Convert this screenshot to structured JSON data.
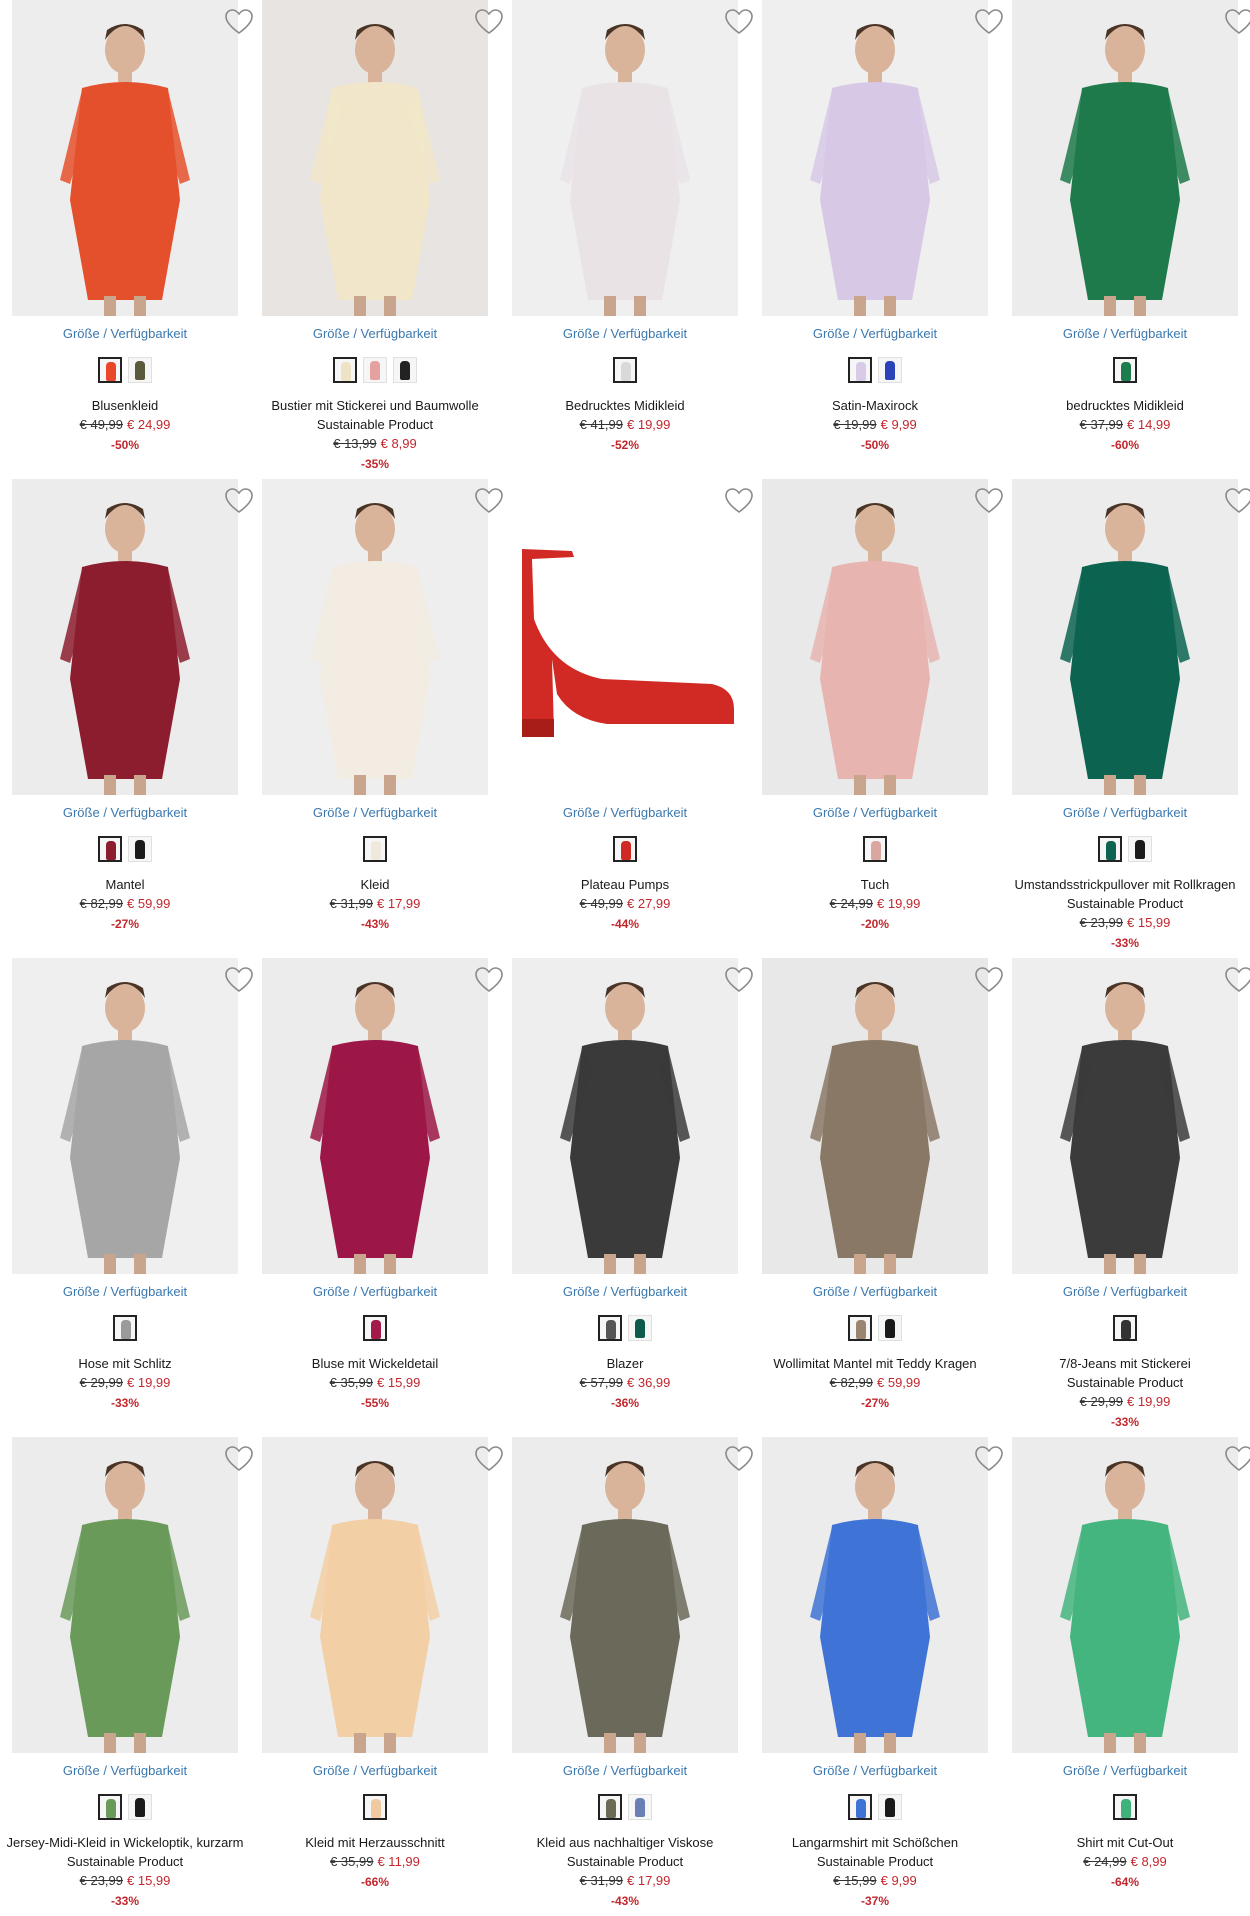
{
  "colors": {
    "accent_link": "#3a78b0",
    "sale_red": "#c1272d"
  },
  "icons": {
    "wishlist": "heart-outline-icon"
  },
  "products": [
    {
      "name": "Blusenkleid",
      "size_link": "Größe / Verfügbarkeit",
      "old_price": "€ 49,99",
      "new_price": "€ 24,99",
      "discount": "-50%",
      "swatches": [
        {
          "color": "#e8472a"
        },
        {
          "color": "#5b5a3a"
        }
      ],
      "img_bg": "#ededed",
      "fig": "#e4502c"
    },
    {
      "name": "Bustier mit Stickerei und Baumwolle",
      "sustainable": "Sustainable Product",
      "size_link": "Größe / Verfügbarkeit",
      "old_price": "€ 13,99",
      "new_price": "€ 8,99",
      "discount": "-35%",
      "swatches": [
        {
          "color": "#efe3c6"
        },
        {
          "color": "#e5a0a0"
        },
        {
          "color": "#222222"
        }
      ],
      "img_bg": "#e7e4e1",
      "fig": "#f1e6c9"
    },
    {
      "name": "Bedrucktes Midikleid",
      "size_link": "Größe / Verfügbarkeit",
      "old_price": "€ 41,99",
      "new_price": "€ 19,99",
      "discount": "-52%",
      "swatches": [
        {
          "color": "#d9d9d9"
        }
      ],
      "img_bg": "#efefef",
      "fig": "#e9e3e6"
    },
    {
      "name": "Satin-Maxirock",
      "size_link": "Größe / Verfügbarkeit",
      "old_price": "€ 19,99",
      "new_price": "€ 9,99",
      "discount": "-50%",
      "swatches": [
        {
          "color": "#d9cbe7"
        },
        {
          "color": "#2a43b8"
        }
      ],
      "img_bg": "#efefef",
      "fig": "#d7c8e6"
    },
    {
      "name": "bedrucktes Midikleid",
      "size_link": "Größe / Verfügbarkeit",
      "old_price": "€ 37,99",
      "new_price": "€ 14,99",
      "discount": "-60%",
      "swatches": [
        {
          "color": "#1d7d4f"
        }
      ],
      "img_bg": "#ececec",
      "fig": "#1f7a4b"
    },
    {
      "name": "Mantel",
      "size_link": "Größe / Verfügbarkeit",
      "old_price": "€ 82,99",
      "new_price": "€ 59,99",
      "discount": "-27%",
      "swatches": [
        {
          "color": "#8c1d2e"
        },
        {
          "color": "#1a1a1a"
        }
      ],
      "img_bg": "#ececec",
      "fig": "#8c1d2e"
    },
    {
      "name": "Kleid",
      "size_link": "Größe / Verfügbarkeit",
      "old_price": "€ 31,99",
      "new_price": "€ 17,99",
      "discount": "-43%",
      "swatches": [
        {
          "color": "#efe8dc"
        }
      ],
      "img_bg": "#eeeeee",
      "fig": "#f2ece2"
    },
    {
      "name": "Plateau Pumps",
      "size_link": "Größe / Verfügbarkeit",
      "old_price": "€ 49,99",
      "new_price": "€ 27,99",
      "discount": "-44%",
      "swatches": [
        {
          "color": "#d12a24"
        }
      ],
      "img_bg": "#ffffff",
      "fig": "#d12a24"
    },
    {
      "name": "Tuch",
      "size_link": "Größe / Verfügbarkeit",
      "old_price": "€ 24,99",
      "new_price": "€ 19,99",
      "discount": "-20%",
      "swatches": [
        {
          "color": "#d9a6a0"
        }
      ],
      "img_bg": "#e9e9e9",
      "fig": "#e7b4b0"
    },
    {
      "name": "Umstandsstrickpullover mit Rollkragen",
      "sustainable": "Sustainable Product",
      "size_link": "Größe / Verfügbarkeit",
      "old_price": "€ 23,99",
      "new_price": "€ 15,99",
      "discount": "-33%",
      "swatches": [
        {
          "color": "#0c6450"
        },
        {
          "color": "#1a1a1a"
        }
      ],
      "img_bg": "#ececec",
      "fig": "#0c6450"
    },
    {
      "name": "Hose mit Schlitz",
      "size_link": "Größe / Verfügbarkeit",
      "old_price": "€ 29,99",
      "new_price": "€ 19,99",
      "discount": "-33%",
      "swatches": [
        {
          "color": "#9a9a9a"
        }
      ],
      "img_bg": "#efefef",
      "fig": "#a6a6a6"
    },
    {
      "name": "Bluse mit Wickeldetail",
      "size_link": "Größe / Verfügbarkeit",
      "old_price": "€ 35,99",
      "new_price": "€ 15,99",
      "discount": "-55%",
      "swatches": [
        {
          "color": "#a11a4a"
        }
      ],
      "img_bg": "#ececec",
      "fig": "#9c1747"
    },
    {
      "name": "Blazer",
      "size_link": "Größe / Verfügbarkeit",
      "old_price": "€ 57,99",
      "new_price": "€ 36,99",
      "discount": "-36%",
      "swatches": [
        {
          "color": "#555555"
        },
        {
          "color": "#0e5a4c"
        }
      ],
      "img_bg": "#eeeeee",
      "fig": "#3a3a3a"
    },
    {
      "name": "Wollimitat Mantel mit Teddy Kragen",
      "size_link": "Größe / Verfügbarkeit",
      "old_price": "€ 82,99",
      "new_price": "€ 59,99",
      "discount": "-27%",
      "swatches": [
        {
          "color": "#9a8670"
        },
        {
          "color": "#1a1a1a"
        }
      ],
      "img_bg": "#e8e8e8",
      "fig": "#8a7866"
    },
    {
      "name": "7/8-Jeans mit Stickerei",
      "sustainable": "Sustainable Product",
      "size_link": "Größe / Verfügbarkeit",
      "old_price": "€ 29,99",
      "new_price": "€ 19,99",
      "discount": "-33%",
      "swatches": [
        {
          "color": "#333333"
        }
      ],
      "img_bg": "#eeeeee",
      "fig": "#3b3b3b"
    },
    {
      "name": "Jersey-Midi-Kleid in Wickeloptik, kurzarm",
      "sustainable": "Sustainable Product",
      "size_link": "Größe / Verfügbarkeit",
      "old_price": "€ 23,99",
      "new_price": "€ 15,99",
      "discount": "-33%",
      "swatches": [
        {
          "color": "#6a9a5a"
        },
        {
          "color": "#1a1a1a"
        }
      ],
      "img_bg": "#ececec",
      "fig": "#6a9a5a"
    },
    {
      "name": "Kleid mit Herzausschnitt",
      "size_link": "Größe / Verfügbarkeit",
      "old_price": "€ 35,99",
      "new_price": "€ 11,99",
      "discount": "-66%",
      "swatches": [
        {
          "color": "#f1c9a0"
        }
      ],
      "img_bg": "#ededed",
      "fig": "#f3cfa5"
    },
    {
      "name": "Kleid aus nachhaltiger Viskose",
      "sustainable": "Sustainable Product",
      "size_link": "Größe / Verfügbarkeit",
      "old_price": "€ 31,99",
      "new_price": "€ 17,99",
      "discount": "-43%",
      "swatches": [
        {
          "color": "#6b6b55"
        },
        {
          "color": "#6a80b4"
        }
      ],
      "img_bg": "#ececec",
      "fig": "#6b6a5a"
    },
    {
      "name": "Langarmshirt mit Schößchen",
      "sustainable": "Sustainable Product",
      "size_link": "Größe / Verfügbarkeit",
      "old_price": "€ 15,99",
      "new_price": "€ 9,99",
      "discount": "-37%",
      "swatches": [
        {
          "color": "#3e72d4"
        },
        {
          "color": "#1a1a1a"
        }
      ],
      "img_bg": "#ececec",
      "fig": "#3f73d6"
    },
    {
      "name": "Shirt mit Cut-Out",
      "size_link": "Größe / Verfügbarkeit",
      "old_price": "€ 24,99",
      "new_price": "€ 8,99",
      "discount": "-64%",
      "swatches": [
        {
          "color": "#3fb27a"
        }
      ],
      "img_bg": "#ececec",
      "fig": "#45b57f"
    }
  ]
}
